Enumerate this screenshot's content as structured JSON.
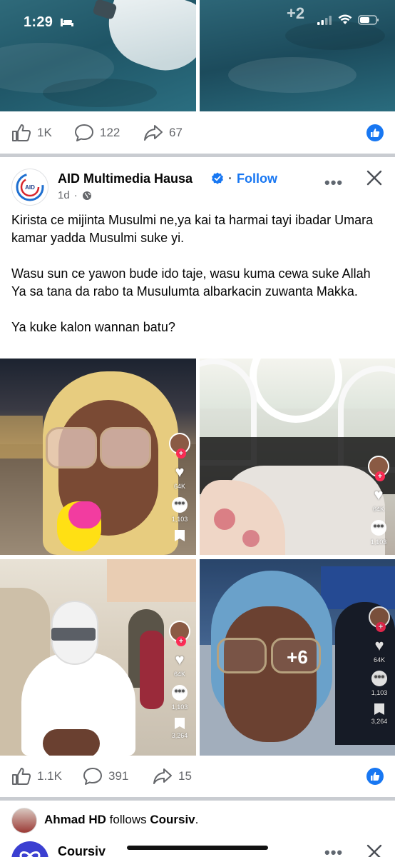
{
  "status_bar": {
    "time": "1:29"
  },
  "top_post": {
    "overflow_count": "+2",
    "actions": {
      "likes": "1K",
      "comments": "122",
      "shares": "67"
    }
  },
  "post": {
    "page_name": "AID Multimedia Hausa",
    "follow_label": "Follow",
    "follow_separator": "·",
    "age": "1d",
    "avatar_text": "AID",
    "more_label": "•••",
    "text": [
      "Kirista ce mijinta Musulmi ne,ya kai ta harmai tayi ibadar Umara kamar yadda Musulmi suke yi.",
      "Wasu sun ce yawon bude ido taje, wasu kuma cewa suke Allah Ya sa tana da rabo ta Musulumta albarkacin zuwanta Makka.",
      "Ya kuke kalon wannan batu?"
    ],
    "media": [
      {
        "likes": "64K",
        "comments": "1,103",
        "saves": ""
      },
      {
        "likes": "64K",
        "comments": "1,103",
        "saves": ""
      },
      {
        "likes": "64K",
        "comments": "1,103",
        "saves": "3,264"
      },
      {
        "likes": "64K",
        "comments": "1,103",
        "saves": "3,264",
        "overflow": "+6"
      }
    ],
    "actions": {
      "likes": "1.1K",
      "comments": "391",
      "shares": "15"
    }
  },
  "suggestion": {
    "actor": "Ahmad HD",
    "verb": "follows",
    "target": "Coursiv",
    "suffix": ".",
    "page_name": "Coursiv",
    "more_label": "•••"
  },
  "colors": {
    "brand_blue": "#1877f2",
    "text_secondary": "#65676b",
    "separator": "#c9ccd1"
  }
}
